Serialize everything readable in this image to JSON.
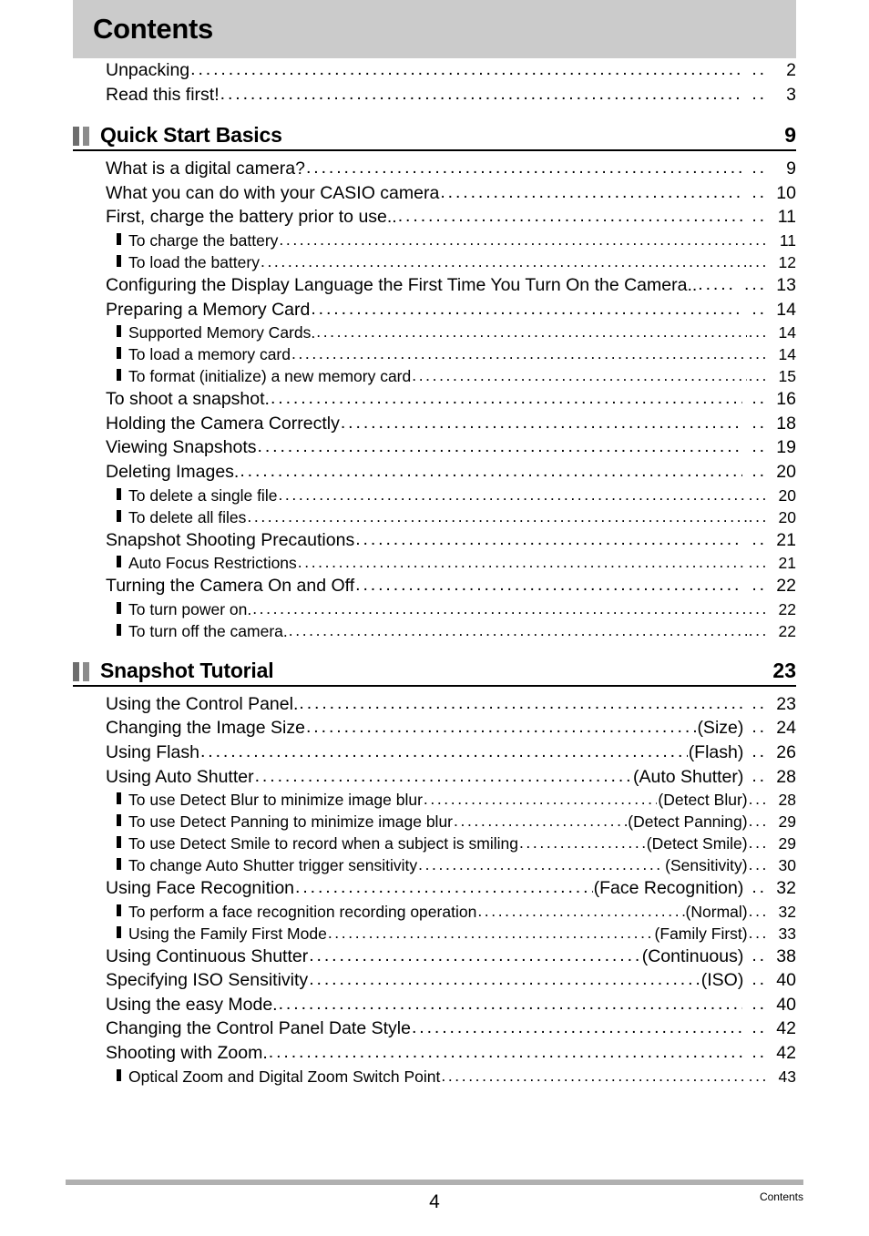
{
  "header": {
    "title": "Contents",
    "band_color": "#cbcbcb"
  },
  "footer": {
    "page_number": "4",
    "label": "Contents",
    "rule_color": "#b0b0b0"
  },
  "intro_entries": [
    {
      "level": 1,
      "label": "Unpacking",
      "suffix": "",
      "page": "2",
      "wide_gap": true
    },
    {
      "level": 1,
      "label": "Read this first!",
      "suffix": "",
      "page": "3",
      "wide_gap": true
    }
  ],
  "sections": [
    {
      "title": "Quick Start Basics",
      "page": "9",
      "marker": "double-bar-icon",
      "entries": [
        {
          "level": 1,
          "label": "What is a digital camera?",
          "suffix": "",
          "page": "9",
          "wide_gap": true
        },
        {
          "level": 1,
          "label": "What you can do with your CASIO camera",
          "suffix": "",
          "page": "10",
          "wide_gap": true
        },
        {
          "level": 1,
          "label": "First, charge the battery prior to use..",
          "suffix": "",
          "page": "11",
          "wide_gap": true
        },
        {
          "level": 2,
          "label": "To charge the battery",
          "suffix": "",
          "page": "11",
          "wide_gap": false
        },
        {
          "level": 2,
          "label": "To load the battery",
          "suffix": "",
          "page": "12",
          "wide_gap": false
        },
        {
          "level": 1,
          "label": "Configuring the Display Language the First Time You Turn On the Camera..",
          "suffix": "",
          "page": "13",
          "wide_gap": false
        },
        {
          "level": 1,
          "label": "Preparing a Memory Card",
          "suffix": "",
          "page": "14",
          "wide_gap": true
        },
        {
          "level": 2,
          "label": "Supported Memory Cards.",
          "suffix": "",
          "page": "14",
          "wide_gap": false
        },
        {
          "level": 2,
          "label": "To load a memory card",
          "suffix": "",
          "page": "14",
          "wide_gap": false
        },
        {
          "level": 2,
          "label": "To format (initialize) a new memory card",
          "suffix": "",
          "page": "15",
          "wide_gap": false
        },
        {
          "level": 1,
          "label": "To shoot a snapshot.",
          "suffix": "",
          "page": "16",
          "wide_gap": true
        },
        {
          "level": 1,
          "label": "Holding the Camera Correctly",
          "suffix": "",
          "page": "18",
          "wide_gap": true
        },
        {
          "level": 1,
          "label": "Viewing Snapshots",
          "suffix": "",
          "page": "19",
          "wide_gap": true
        },
        {
          "level": 1,
          "label": "Deleting Images.",
          "suffix": "",
          "page": "20",
          "wide_gap": true
        },
        {
          "level": 2,
          "label": "To delete a single file",
          "suffix": "",
          "page": "20",
          "wide_gap": false
        },
        {
          "level": 2,
          "label": "To delete all files",
          "suffix": "",
          "page": "20",
          "wide_gap": false
        },
        {
          "level": 1,
          "label": "Snapshot Shooting Precautions",
          "suffix": "",
          "page": "21",
          "wide_gap": true
        },
        {
          "level": 2,
          "label": "Auto Focus Restrictions",
          "suffix": "",
          "page": "21",
          "wide_gap": false
        },
        {
          "level": 1,
          "label": "Turning the Camera On and Off",
          "suffix": "",
          "page": "22",
          "wide_gap": true
        },
        {
          "level": 2,
          "label": "To turn power on.",
          "suffix": "",
          "page": "22",
          "wide_gap": false
        },
        {
          "level": 2,
          "label": "To turn off the camera.",
          "suffix": "",
          "page": "22",
          "wide_gap": false
        }
      ]
    },
    {
      "title": "Snapshot Tutorial",
      "page": "23",
      "marker": "double-bar-icon",
      "entries": [
        {
          "level": 1,
          "label": "Using the Control Panel.",
          "suffix": "",
          "page": "23",
          "wide_gap": true
        },
        {
          "level": 1,
          "label": "Changing the Image Size",
          "suffix": "(Size)",
          "page": "24",
          "wide_gap": true
        },
        {
          "level": 1,
          "label": "Using Flash",
          "suffix": "(Flash)",
          "page": "26",
          "wide_gap": true
        },
        {
          "level": 1,
          "label": "Using Auto Shutter",
          "suffix": "(Auto Shutter)",
          "page": "28",
          "wide_gap": true
        },
        {
          "level": 2,
          "label": "To use Detect Blur to minimize image blur",
          "suffix": "(Detect Blur)",
          "page": "28",
          "wide_gap": false
        },
        {
          "level": 2,
          "label": "To use Detect Panning to minimize image blur",
          "suffix": "(Detect Panning)",
          "page": "29",
          "wide_gap": false
        },
        {
          "level": 2,
          "label": "To use Detect Smile to record when a subject is smiling",
          "suffix": "(Detect Smile)",
          "page": "29",
          "wide_gap": false
        },
        {
          "level": 2,
          "label": "To change Auto Shutter trigger sensitivity",
          "suffix": "(Sensitivity)",
          "page": "30",
          "wide_gap": false
        },
        {
          "level": 1,
          "label": "Using Face Recognition",
          "suffix": "(Face Recognition)",
          "page": "32",
          "wide_gap": true
        },
        {
          "level": 2,
          "label": "To perform a face recognition recording operation",
          "suffix": "(Normal)",
          "page": "32",
          "wide_gap": false
        },
        {
          "level": 2,
          "label": "Using the Family First Mode",
          "suffix": "(Family First)",
          "page": "33",
          "wide_gap": false
        },
        {
          "level": 1,
          "label": "Using Continuous Shutter",
          "suffix": "(Continuous)",
          "page": "38",
          "wide_gap": true
        },
        {
          "level": 1,
          "label": "Specifying ISO Sensitivity",
          "suffix": "(ISO)",
          "page": "40",
          "wide_gap": true
        },
        {
          "level": 1,
          "label": "Using the easy Mode.",
          "suffix": "",
          "page": "40",
          "wide_gap": true
        },
        {
          "level": 1,
          "label": "Changing the Control Panel Date Style",
          "suffix": "",
          "page": "42",
          "wide_gap": true
        },
        {
          "level": 1,
          "label": "Shooting with Zoom.",
          "suffix": "",
          "page": "42",
          "wide_gap": true
        },
        {
          "level": 2,
          "label": "Optical Zoom and Digital Zoom Switch Point",
          "suffix": "",
          "page": "43",
          "wide_gap": false
        }
      ]
    }
  ]
}
